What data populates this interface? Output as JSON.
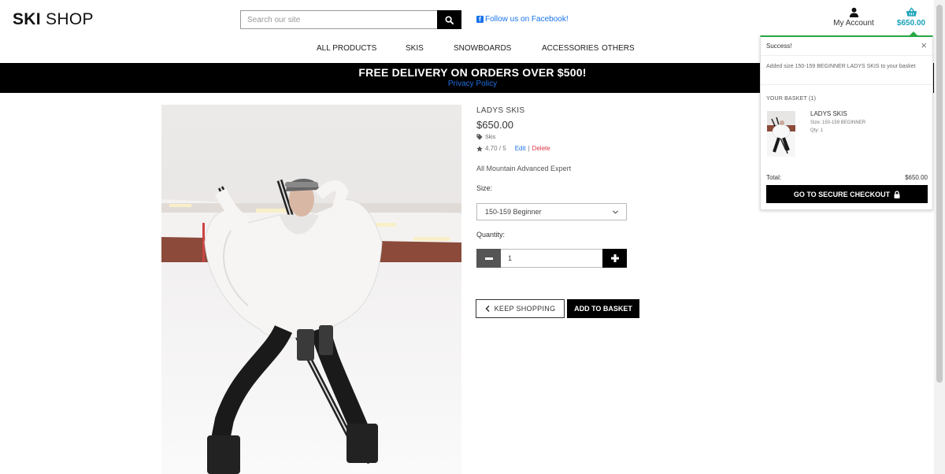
{
  "brand": {
    "bold": "SKI",
    "light": " SHOP"
  },
  "search": {
    "placeholder": "Search our site"
  },
  "facebook": {
    "label": "Follow us on Facebook!"
  },
  "account": {
    "label": "My Account"
  },
  "basket": {
    "total": "$650.00",
    "color": "#17a2b8"
  },
  "nav": {
    "items": [
      {
        "label": "ALL PRODUCTS"
      },
      {
        "label": "SKIS"
      },
      {
        "label": "SNOWBOARDS"
      },
      {
        "label": "ACCESSORIES"
      },
      {
        "label": "OTHERS"
      }
    ]
  },
  "banner": {
    "title": "FREE DELIVERY ON ORDERS OVER $500!",
    "link": "Privacy Policy"
  },
  "product": {
    "name": "LADYS SKIS",
    "price": "$650.00",
    "category": "Skis",
    "rating": "4.70 / 5",
    "edit": "Edit",
    "separator": "|",
    "delete": "Delete",
    "description": "All Mountain Advanced Expert",
    "size_label": "Size:",
    "size_selected": "150-159 Beginner",
    "quantity_label": "Quantity:",
    "quantity": "1",
    "keep_shopping": "KEEP SHOPPING",
    "add_to_basket": "ADD TO BASKET"
  },
  "toast": {
    "title": "Success!",
    "message": "Added size 150-159 BEGINNER LADYS SKIS to your basket",
    "basket_heading": "YOUR BASKET (1)",
    "item": {
      "name": "LADYS SKIS",
      "size": "Size: 150-159 BEGINNER",
      "qty": "Qty: 1"
    },
    "total_label": "Total:",
    "total_value": "$650.00",
    "checkout": "GO TO SECURE CHECKOUT",
    "accent_color": "#28a745"
  },
  "icons": [
    "search-icon",
    "facebook-icon",
    "user-icon",
    "basket-icon",
    "tag-icon",
    "star-icon",
    "chevron-down-icon",
    "minus-icon",
    "plus-icon",
    "chevron-left-icon",
    "close-icon",
    "lock-icon"
  ]
}
